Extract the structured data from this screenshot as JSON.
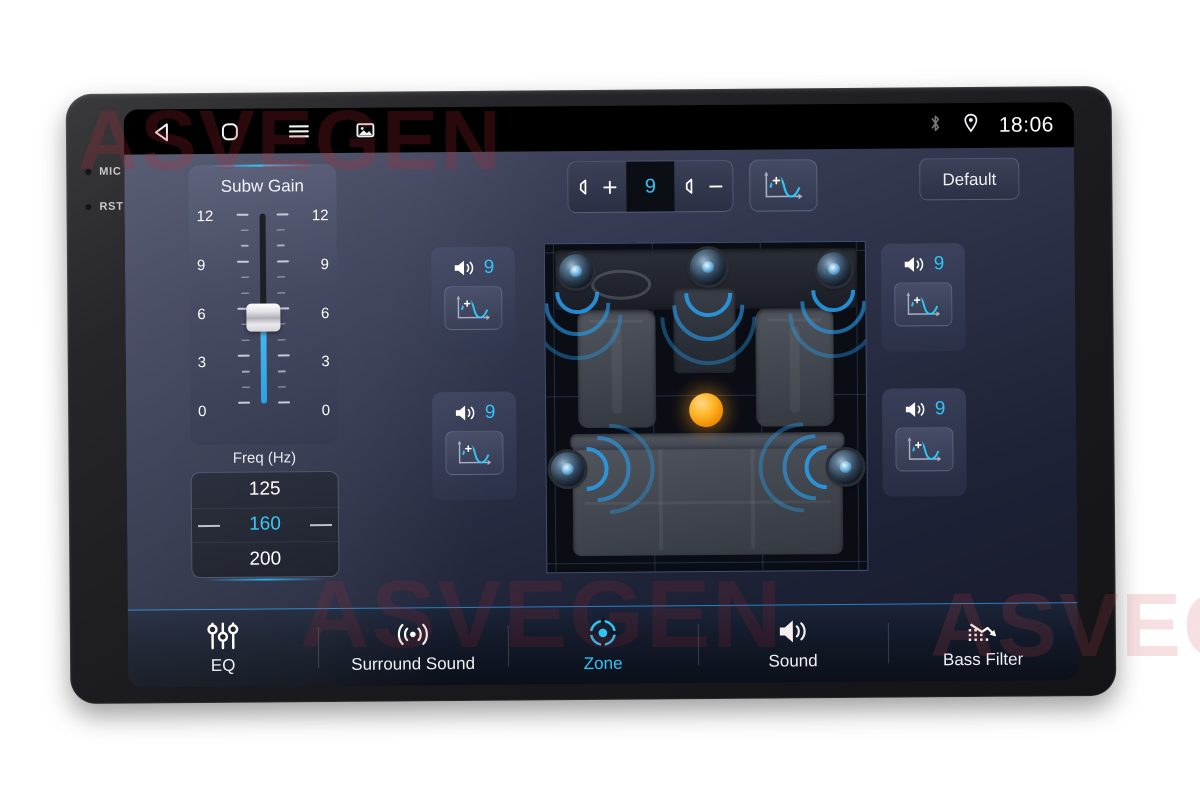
{
  "device": {
    "side_controls": [
      {
        "label": "MIC",
        "name": "mic-pinhole"
      },
      {
        "label": "RST",
        "name": "rst-pinhole"
      }
    ]
  },
  "watermark": {
    "text": "ASVEGEN"
  },
  "statusbar": {
    "nav": [
      {
        "icon": "back-triangle-icon",
        "label": "Back"
      },
      {
        "icon": "home-square-icon",
        "label": "Home"
      },
      {
        "icon": "menu-hamburger-icon",
        "label": "Menu"
      },
      {
        "icon": "screenshot-image-icon",
        "label": "Screenshot"
      }
    ],
    "bluetooth_icon": "bluetooth-icon",
    "location_icon": "location-pin-icon",
    "time": "18:06"
  },
  "subwoofer": {
    "title": "Subw Gain",
    "scale_labels": [
      "12",
      "9",
      "6",
      "3",
      "0"
    ],
    "value": 6.6,
    "min": 0,
    "max": 12,
    "freq_caption": "Freq (Hz)",
    "freq_options": [
      "125",
      "160",
      "200"
    ],
    "freq_selected": "160"
  },
  "master_volume": {
    "increase_icon": "volume-up-icon",
    "decrease_icon": "volume-down-icon",
    "value": "9",
    "phase_icon": "phase-waveform-icon"
  },
  "default_button": {
    "label": "Default"
  },
  "zones": [
    {
      "name": "front-left",
      "position": "zp-fl",
      "speaker_icon": "speaker-icon",
      "value": "9",
      "phase_icon": "phase-waveform-icon"
    },
    {
      "name": "rear-left",
      "position": "zp-rl",
      "speaker_icon": "speaker-icon",
      "value": "9",
      "phase_icon": "phase-waveform-icon"
    },
    {
      "name": "front-right",
      "position": "zp-fr",
      "speaker_icon": "speaker-icon",
      "value": "9",
      "phase_icon": "phase-waveform-icon"
    },
    {
      "name": "rear-right",
      "position": "zp-rr",
      "speaker_icon": "speaker-icon",
      "value": "9",
      "phase_icon": "phase-waveform-icon"
    }
  ],
  "car_diagram": {
    "marker_icon": "sound-position-marker",
    "speakers": [
      "front-left-speaker",
      "center-speaker",
      "front-right-speaker",
      "rear-left-speaker",
      "rear-right-speaker"
    ]
  },
  "tabs": [
    {
      "label": "EQ",
      "icon": "equalizer-sliders-icon",
      "active": false
    },
    {
      "label": "Surround Sound",
      "icon": "surround-waves-icon",
      "active": false
    },
    {
      "label": "Zone",
      "icon": "zone-target-icon",
      "active": true
    },
    {
      "label": "Sound",
      "icon": "speaker-icon",
      "active": false
    },
    {
      "label": "Bass Filter",
      "icon": "bass-filter-icon",
      "active": false
    }
  ],
  "colors": {
    "accent_cyan": "#2fc4f7",
    "marker_orange": "#ffb627",
    "wave_blue": "#28a0f0"
  }
}
